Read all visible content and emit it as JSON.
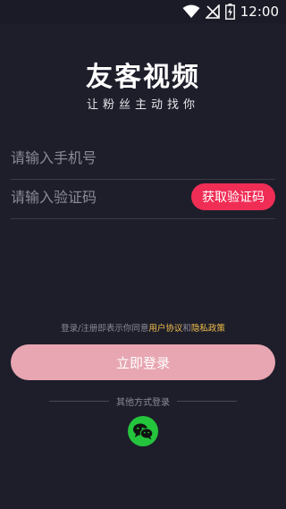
{
  "status_bar": {
    "time": "12:00",
    "icons": [
      "wifi-icon",
      "signal-off-icon",
      "battery-charging-icon"
    ]
  },
  "logo": {
    "title": "友客视频",
    "slogan": "让粉丝主动找你"
  },
  "form": {
    "phone_placeholder": "请输入手机号",
    "code_placeholder": "请输入验证码",
    "get_code_label": "获取验证码"
  },
  "agreement": {
    "prefix": "登录/注册即表示你同意",
    "user_agreement": "用户协议",
    "conjunction": "和",
    "privacy_policy": "隐私政策"
  },
  "login_button": "立即登录",
  "other_login": {
    "label": "其他方式登录",
    "methods": [
      "wechat-icon"
    ]
  },
  "colors": {
    "background": "#1e1e2b",
    "accent": "#f02d55",
    "login_button": "#e7a6b1",
    "link": "#f2c04a",
    "wechat": "#25c43d"
  }
}
